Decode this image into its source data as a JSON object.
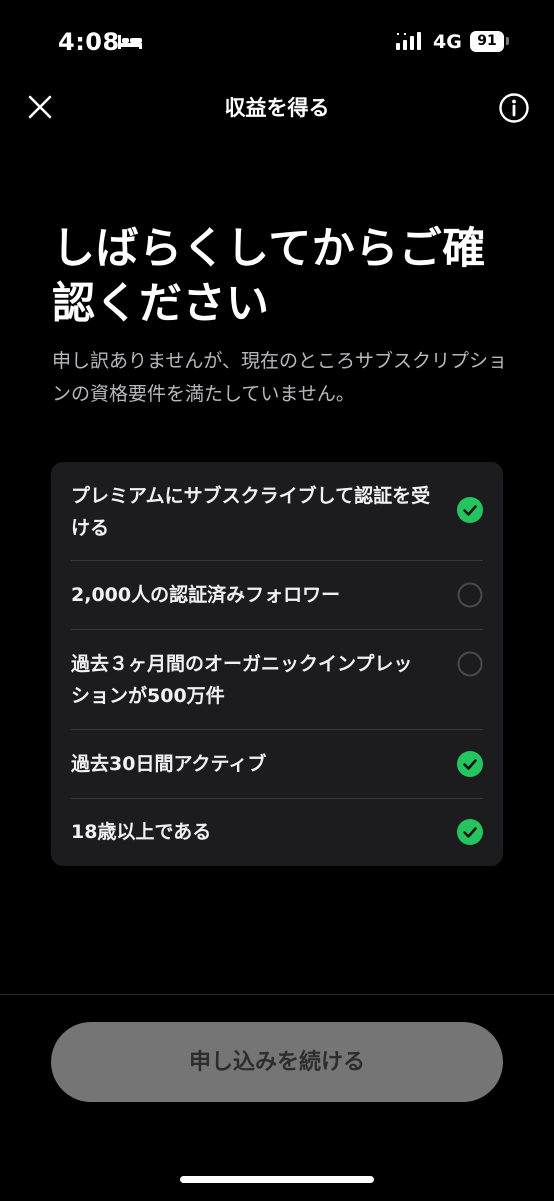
{
  "status_bar": {
    "time": "4:08",
    "network": "4G",
    "battery": "91"
  },
  "nav": {
    "title": "収益を得る"
  },
  "headline": "しばらくしてからご確認ください",
  "subtext": "申し訳ありませんが、現在のところサブスクリプションの資格要件を満たしていません。",
  "requirements": [
    {
      "text": "プレミアムにサブスクライブして認証を受ける",
      "met": true
    },
    {
      "text": "2,000人の認証済みフォロワー",
      "met": false
    },
    {
      "text": "過去３ヶ月間のオーガニックインプレッションが500万件",
      "met": false
    },
    {
      "text": "過去30日間アクティブ",
      "met": true
    },
    {
      "text": "18歳以上である",
      "met": true
    }
  ],
  "continue_button": "申し込みを続ける",
  "colors": {
    "check_met": "#22c55e",
    "check_unmet_border": "#4a4a4e",
    "button_bg": "#757575"
  }
}
